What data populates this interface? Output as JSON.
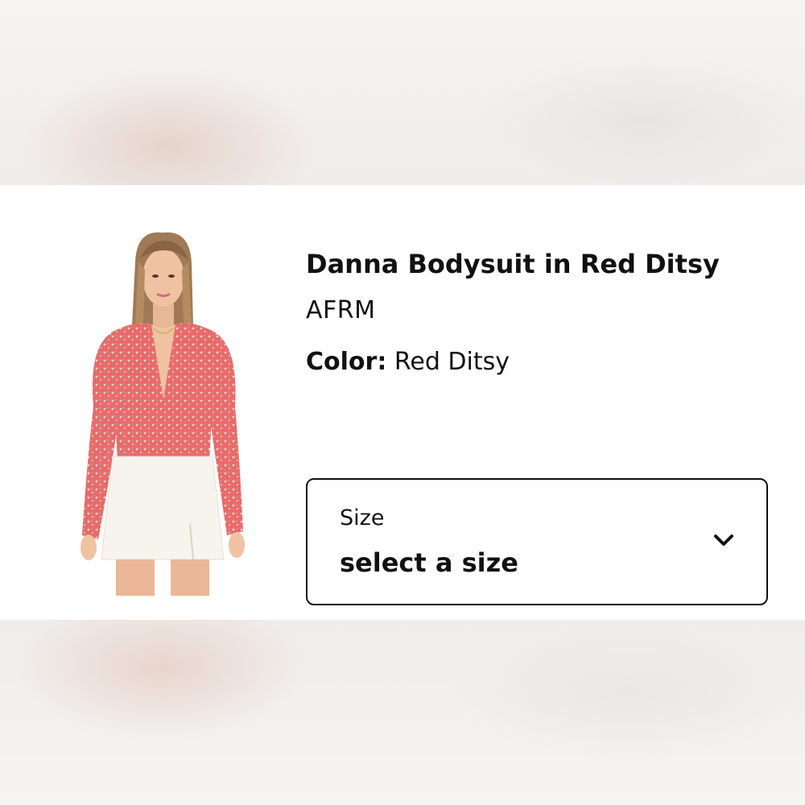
{
  "product": {
    "title": "Danna Bodysuit in Red Ditsy",
    "brand": "AFRM",
    "color_label": "Color:",
    "color_value": "Red Ditsy"
  },
  "size_select": {
    "caption": "Size",
    "value": "select a size",
    "icon": "chevron-down-icon"
  },
  "colors": {
    "text": "#111111",
    "card_background": "#ffffff",
    "top_fabric": "#e86a6e",
    "skirt": "#f7f4ee"
  }
}
